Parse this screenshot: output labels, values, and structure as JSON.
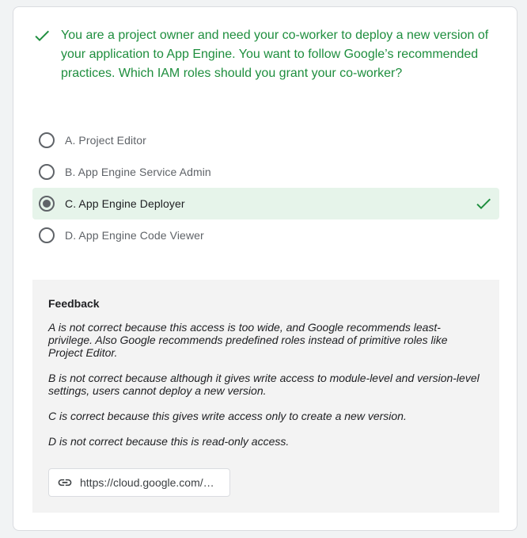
{
  "question": {
    "text": "You are a project owner and need your co-worker to deploy a new version of your application to App Engine. You want to follow Google’s recommended practices. Which IAM roles should you grant your co-worker?",
    "status_icon": "check-icon",
    "accent_color": "#1e8e3e"
  },
  "options": [
    {
      "label": "A. Project Editor",
      "selected": false,
      "correct": false
    },
    {
      "label": "B. App Engine Service Admin",
      "selected": false,
      "correct": false
    },
    {
      "label": "C. App Engine Deployer",
      "selected": true,
      "correct": true
    },
    {
      "label": "D. App Engine Code Viewer",
      "selected": false,
      "correct": false
    }
  ],
  "feedback": {
    "title": "Feedback",
    "paragraphs": [
      "A is not correct because this access is too wide, and Google recommends least-privilege. Also Google recommends predefined roles instead of primitive roles like Project Editor.",
      "B is not correct because although it gives write access to module-level and version-level settings, users cannot deploy a new version.",
      "C is correct because this gives write access only to create a new version.",
      "D is not correct because this is read-only access."
    ],
    "link": {
      "text": "https://cloud.google.com/…",
      "icon": "link-icon"
    }
  }
}
